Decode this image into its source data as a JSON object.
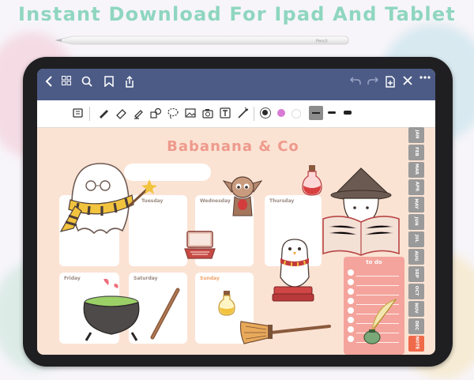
{
  "headline": "Instant Download For Ipad And Tablet",
  "pencil_brand": "Pencil",
  "colors": {
    "headline": "#8fd6bf",
    "navbar": "#4c5b86",
    "page_bg": "#fbe3d4",
    "title": "#ee9a8c",
    "todo_bg": "#f4a49c",
    "tab_grey": "#9a9a9a",
    "tab_note": "#ef6a4a"
  },
  "navbar": {
    "left_icons": [
      "back-chevron-icon",
      "grid-icon",
      "search-icon",
      "bookmark-icon",
      "share-icon"
    ],
    "right_icons": [
      "undo-icon",
      "redo-icon",
      "add-page-icon",
      "close-icon",
      "more-icon"
    ]
  },
  "toolbar": {
    "tools": [
      "keyboard-icon",
      "pen-icon",
      "eraser-icon",
      "highlighter-icon",
      "shapes-icon",
      "lasso-icon",
      "image-icon",
      "camera-icon",
      "text-icon",
      "pointer-icon"
    ],
    "swatches": [
      "#2b2b2b",
      "#d77bd4",
      "#ffffff"
    ],
    "selected_swatch": "#2b2b2b"
  },
  "planner": {
    "title": "Babanana & Co",
    "days": {
      "tuesday": "Tuesday",
      "wednesday": "Wednesday",
      "thursday": "Thursday",
      "friday": "Friday",
      "saturday": "Saturday",
      "sunday": "Sunday"
    },
    "todo_label": "to do"
  },
  "month_tabs": [
    "JAN",
    "FEB",
    "MAR",
    "APR",
    "MAY",
    "JUN",
    "JUL",
    "AUG",
    "SEP",
    "OCT",
    "NOV",
    "DEC",
    "NOTE"
  ]
}
